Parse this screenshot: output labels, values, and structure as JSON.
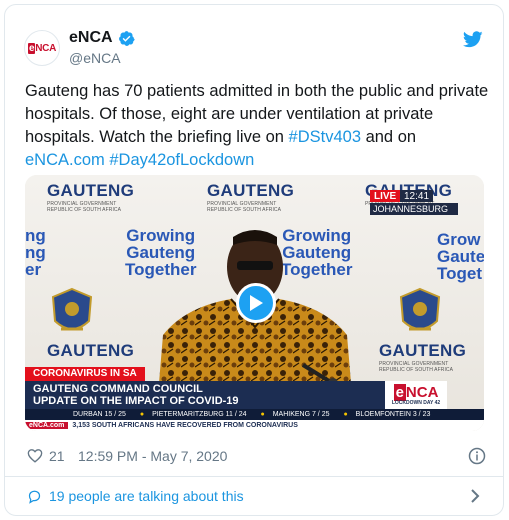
{
  "author": {
    "name": "eNCA",
    "handle": "@eNCA",
    "avatar_text": "eNCA"
  },
  "tweet": {
    "line1": "Gauteng has 70 patients admitted in both the public and private",
    "line2": "hospitals. Of those, eight are under ventilation at private",
    "line3_prefix": "hospitals. Watch the briefing live on ",
    "hashtag1": "#DStv403",
    "line3_suffix": " and on",
    "link": "eNCA.com",
    "hashtag2": "#Day42ofLockdown"
  },
  "video": {
    "backdrop": {
      "gauteng": "GAUTENG",
      "gov_line1": "PROVINCIAL GOVERNMENT",
      "gov_line2": "REPUBLIC OF SOUTH AFRICA",
      "slogan1": "Growing",
      "slogan2": "Gauteng",
      "slogan3": "Together",
      "partial_left1": "ng",
      "partial_left2": "ng",
      "partial_left3": "er",
      "partial_right1": "Grow",
      "partial_right2": "Gaute",
      "partial_right3": "Toget",
      "gauteng_top_right": "GAUTENG",
      "gauteng_bottom_right": "GAUTENG"
    },
    "live_label": "LIVE",
    "live_time": "12:41",
    "live_city": "JOHANNESBURG",
    "ticker_label": "CORONAVIRUS IN SA",
    "headline1": "GAUTENG COMMAND COUNCIL",
    "headline2": "UPDATE ON THE IMPACT OF COVID-19",
    "brand": "NCA",
    "brand_e": "e",
    "lockdown": "LOCKDOWN DAY 42",
    "weather": [
      "DURBAN 15 / 25",
      "PIETERMARITZBURG 11 / 24",
      "MAHIKENG 7 / 25",
      "BLOEMFONTEIN 3 / 23"
    ],
    "news_source": "eNCA.com",
    "news_text": "3,153 SOUTH AFRICANS HAVE RECOVERED FROM CORONAVIRUS"
  },
  "footer": {
    "likes": "21",
    "timestamp": "12:59 PM - May 7, 2020",
    "talking": "19 people are talking about this"
  },
  "colors": {
    "link": "#1b95e0",
    "twitter_blue": "#1da1f2",
    "enca_red": "#c8102e",
    "muted": "#657786"
  }
}
